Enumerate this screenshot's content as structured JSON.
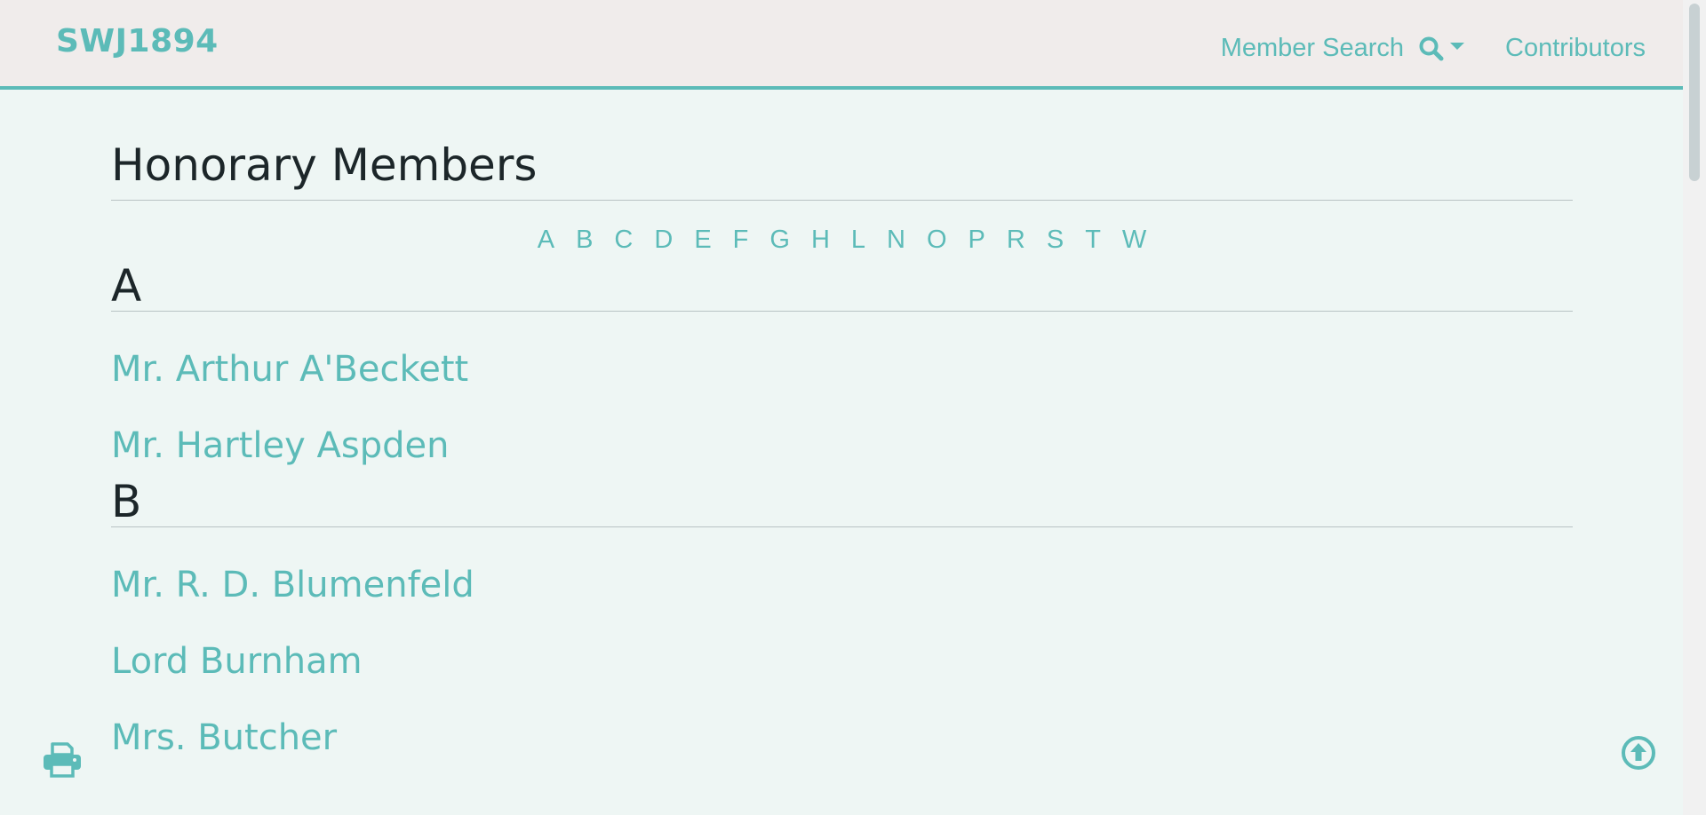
{
  "navbar": {
    "brand": "SWJ1894",
    "member_search_label": "Member Search",
    "contributors_label": "Contributors"
  },
  "main": {
    "title": "Honorary Members",
    "alphabet": [
      "A",
      "B",
      "C",
      "D",
      "E",
      "F",
      "G",
      "H",
      "L",
      "N",
      "O",
      "P",
      "R",
      "S",
      "T",
      "W"
    ],
    "sections": [
      {
        "letter": "A",
        "members": [
          "Mr. Arthur A'Beckett",
          "Mr. Hartley Aspden"
        ]
      },
      {
        "letter": "B",
        "members": [
          "Mr. R. D. Blumenfeld",
          "Lord Burnham",
          "Mrs. Butcher"
        ]
      }
    ]
  },
  "icons": {
    "search": "search-icon",
    "caret": "chevron-down-icon",
    "print": "print-icon",
    "back_to_top": "arrow-up-circle-icon"
  },
  "colors": {
    "accent": "#5cbbb8",
    "navbar_bg": "#f0eceb",
    "page_bg": "#eef6f4",
    "heading": "#1c2629"
  }
}
